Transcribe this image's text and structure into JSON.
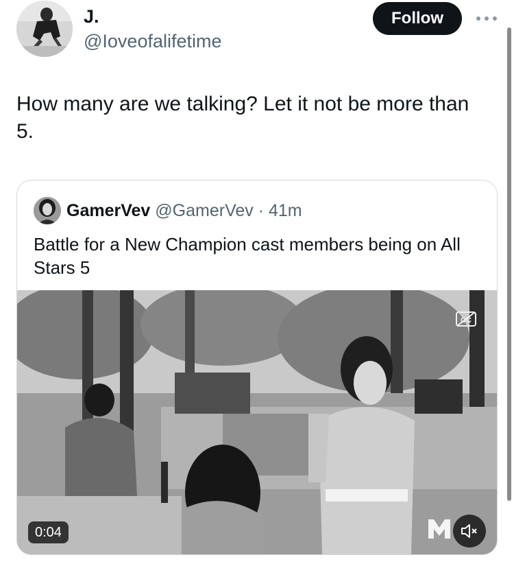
{
  "post": {
    "author": {
      "display_name": "J.",
      "handle": "@Ioveofalifetime"
    },
    "follow_label": "Follow",
    "text": "How many are we talking? Let it not be more than 5."
  },
  "quote": {
    "author": {
      "display_name": "GamerVev",
      "handle": "@GamerVev",
      "time": "41m"
    },
    "meta_separator": "·",
    "text": "Battle for a New Champion cast members being on All Stars 5",
    "video": {
      "timestamp": "0:04",
      "muted": true,
      "captions_available": true
    }
  },
  "icons": {
    "more": "more-horizontal-icon",
    "mute": "volume-muted-icon",
    "captions": "closed-captions-icon",
    "network_logo": "mtv-logo"
  },
  "colors": {
    "text_primary": "#0f1419",
    "text_secondary": "#536471",
    "follow_bg": "#0f1419",
    "border": "#d3d8dc"
  }
}
